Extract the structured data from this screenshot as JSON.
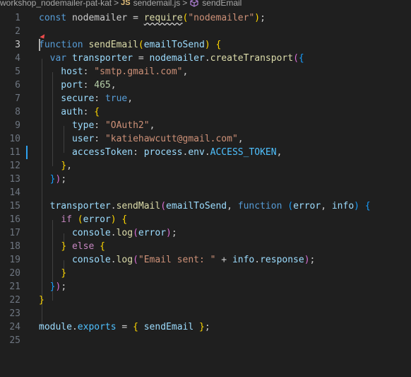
{
  "breadcrumb": {
    "folder": "workshop_nodemailer-pat-kat",
    "separator": ">",
    "file_badge": "JS",
    "file": "sendemail.js",
    "symbol_icon": "cube-icon",
    "symbol": "sendEmail"
  },
  "colors": {
    "background": "#1f1f1f",
    "keyword": "#569cd6",
    "string": "#ce9178",
    "function": "#dcdcaa",
    "variable": "#9cdcfe"
  },
  "lines": [
    {
      "n": "1",
      "tokens": [
        [
          "const ",
          "kw"
        ],
        [
          "nodemailer",
          "tx"
        ],
        [
          " = ",
          "tx"
        ],
        [
          "require",
          "fn squiggle"
        ],
        [
          "(",
          "b1"
        ],
        [
          "\"nodemailer\"",
          "str"
        ],
        [
          ")",
          "b1"
        ],
        [
          ";",
          "tx"
        ]
      ]
    },
    {
      "n": "2",
      "tokens": []
    },
    {
      "n": "3",
      "tokens": [
        [
          "function ",
          "kw"
        ],
        [
          "sendEmail",
          "fn"
        ],
        [
          "(",
          "b1"
        ],
        [
          "emailToSend",
          "var"
        ],
        [
          ") ",
          "b1"
        ],
        [
          "{",
          "b1"
        ]
      ]
    },
    {
      "n": "4",
      "tokens": [
        [
          "  var ",
          "kw"
        ],
        [
          "transporter",
          "var"
        ],
        [
          " = ",
          "tx"
        ],
        [
          "nodemailer",
          "var"
        ],
        [
          ".",
          "tx"
        ],
        [
          "createTransport",
          "fn"
        ],
        [
          "(",
          "b2"
        ],
        [
          "{",
          "b3"
        ]
      ]
    },
    {
      "n": "5",
      "tokens": [
        [
          "    host",
          "var"
        ],
        [
          ": ",
          "tx"
        ],
        [
          "\"smtp.gmail.com\"",
          "str"
        ],
        [
          ",",
          "tx"
        ]
      ]
    },
    {
      "n": "6",
      "tokens": [
        [
          "    port",
          "var"
        ],
        [
          ": ",
          "tx"
        ],
        [
          "465",
          "num"
        ],
        [
          ",",
          "tx"
        ]
      ]
    },
    {
      "n": "7",
      "tokens": [
        [
          "    secure",
          "var"
        ],
        [
          ": ",
          "tx"
        ],
        [
          "true",
          "kw"
        ],
        [
          ",",
          "tx"
        ]
      ]
    },
    {
      "n": "8",
      "tokens": [
        [
          "    auth",
          "var"
        ],
        [
          ": ",
          "tx"
        ],
        [
          "{",
          "b1"
        ]
      ]
    },
    {
      "n": "9",
      "tokens": [
        [
          "      type",
          "var"
        ],
        [
          ": ",
          "tx"
        ],
        [
          "\"OAuth2\"",
          "str"
        ],
        [
          ",",
          "tx"
        ]
      ]
    },
    {
      "n": "10",
      "tokens": [
        [
          "      user",
          "var"
        ],
        [
          ": ",
          "tx"
        ],
        [
          "\"katiehawcutt@gmail.com\"",
          "str"
        ],
        [
          ",",
          "tx"
        ]
      ]
    },
    {
      "n": "11",
      "tokens": [
        [
          "      accessToken",
          "var"
        ],
        [
          ": ",
          "tx"
        ],
        [
          "process",
          "var"
        ],
        [
          ".",
          "tx"
        ],
        [
          "env",
          "var"
        ],
        [
          ".",
          "tx"
        ],
        [
          "ACCESS_TOKEN",
          "const"
        ],
        [
          ",",
          "tx"
        ]
      ]
    },
    {
      "n": "12",
      "tokens": [
        [
          "    ",
          "tx"
        ],
        [
          "}",
          "b1"
        ],
        [
          ",",
          "tx"
        ]
      ]
    },
    {
      "n": "13",
      "tokens": [
        [
          "  ",
          "tx"
        ],
        [
          "}",
          "b3"
        ],
        [
          ")",
          "b2"
        ],
        [
          ";",
          "tx"
        ]
      ]
    },
    {
      "n": "14",
      "tokens": []
    },
    {
      "n": "15",
      "tokens": [
        [
          "  transporter",
          "var"
        ],
        [
          ".",
          "tx"
        ],
        [
          "sendMail",
          "fn"
        ],
        [
          "(",
          "b2"
        ],
        [
          "emailToSend",
          "var"
        ],
        [
          ", ",
          "tx"
        ],
        [
          "function ",
          "kw"
        ],
        [
          "(",
          "b3"
        ],
        [
          "error",
          "var"
        ],
        [
          ", ",
          "tx"
        ],
        [
          "info",
          "var"
        ],
        [
          ") ",
          "b3"
        ],
        [
          "{",
          "b3"
        ]
      ]
    },
    {
      "n": "16",
      "tokens": [
        [
          "    if ",
          "ctrl"
        ],
        [
          "(",
          "b1"
        ],
        [
          "error",
          "var"
        ],
        [
          ") ",
          "b1"
        ],
        [
          "{",
          "b1"
        ]
      ]
    },
    {
      "n": "17",
      "tokens": [
        [
          "      console",
          "var"
        ],
        [
          ".",
          "tx"
        ],
        [
          "log",
          "fn"
        ],
        [
          "(",
          "b2"
        ],
        [
          "error",
          "var"
        ],
        [
          ")",
          "b2"
        ],
        [
          ";",
          "tx"
        ]
      ]
    },
    {
      "n": "18",
      "tokens": [
        [
          "    ",
          "tx"
        ],
        [
          "}",
          "b1"
        ],
        [
          " else ",
          "ctrl"
        ],
        [
          "{",
          "b1"
        ]
      ]
    },
    {
      "n": "19",
      "tokens": [
        [
          "      console",
          "var"
        ],
        [
          ".",
          "tx"
        ],
        [
          "log",
          "fn"
        ],
        [
          "(",
          "b2"
        ],
        [
          "\"Email sent: \"",
          "str"
        ],
        [
          " + ",
          "tx"
        ],
        [
          "info",
          "var"
        ],
        [
          ".",
          "tx"
        ],
        [
          "response",
          "var"
        ],
        [
          ")",
          "b2"
        ],
        [
          ";",
          "tx"
        ]
      ]
    },
    {
      "n": "20",
      "tokens": [
        [
          "    ",
          "tx"
        ],
        [
          "}",
          "b1"
        ]
      ]
    },
    {
      "n": "21",
      "tokens": [
        [
          "  ",
          "tx"
        ],
        [
          "}",
          "b3"
        ],
        [
          ")",
          "b2"
        ],
        [
          ";",
          "tx"
        ]
      ]
    },
    {
      "n": "22",
      "tokens": [
        [
          "}",
          "b1"
        ]
      ]
    },
    {
      "n": "23",
      "tokens": []
    },
    {
      "n": "24",
      "tokens": [
        [
          "module",
          "var"
        ],
        [
          ".",
          "tx"
        ],
        [
          "exports",
          "const"
        ],
        [
          " = ",
          "tx"
        ],
        [
          "{ ",
          "b1"
        ],
        [
          "sendEmail",
          "var"
        ],
        [
          " }",
          "b1"
        ],
        [
          ";",
          "tx"
        ]
      ]
    },
    {
      "n": "25",
      "tokens": []
    }
  ]
}
